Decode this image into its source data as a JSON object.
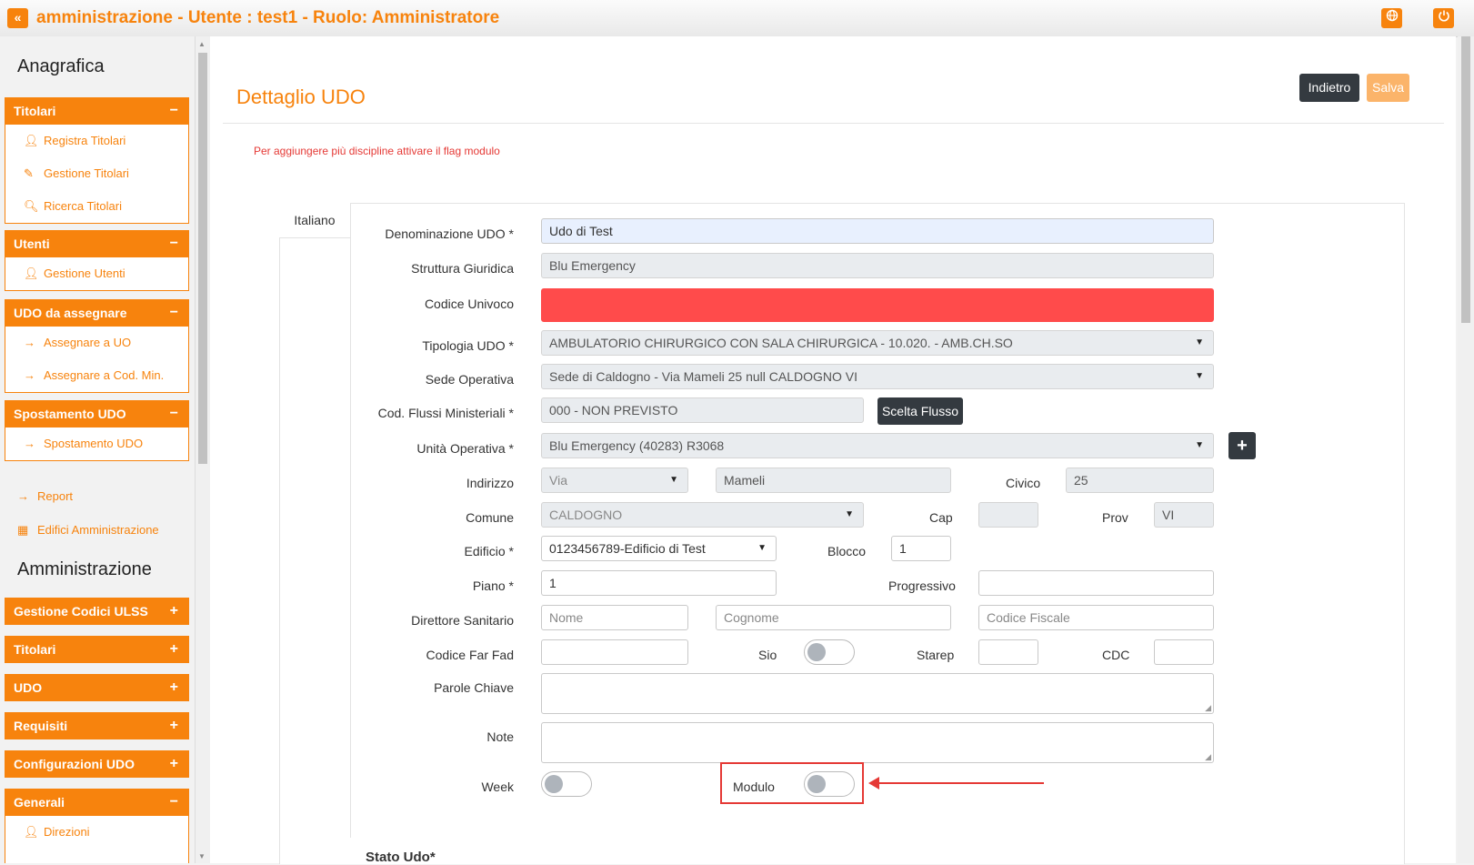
{
  "topbar": {
    "back_icon": "«",
    "title": "amministrazione - Utente : test1 - Ruolo: Amministratore",
    "globe_icon": "globe-icon",
    "power_icon": "power-icon"
  },
  "sidebar": {
    "section_anagrafica": "Anagrafica",
    "groups": [
      {
        "title": "Titolari",
        "toggle": "−",
        "items": [
          "Registra Titolari",
          "Gestione Titolari",
          "Ricerca Titolari"
        ]
      },
      {
        "title": "Utenti",
        "toggle": "−",
        "items": [
          "Gestione Utenti"
        ]
      },
      {
        "title": "UDO da assegnare",
        "toggle": "−",
        "items": [
          "Assegnare a UO",
          "Assegnare a Cod. Min."
        ]
      },
      {
        "title": "Spostamento UDO",
        "toggle": "−",
        "items": [
          "Spostamento UDO"
        ]
      }
    ],
    "loose_items": [
      "Report",
      "Edifici Amministrazione"
    ],
    "section_amministrazione": "Amministrazione",
    "admin_groups": [
      {
        "title": "Gestione Codici ULSS",
        "toggle": "+"
      },
      {
        "title": "Titolari",
        "toggle": "+"
      },
      {
        "title": "UDO",
        "toggle": "+"
      },
      {
        "title": "Requisiti",
        "toggle": "+"
      },
      {
        "title": "Configurazioni UDO",
        "toggle": "+"
      },
      {
        "title": "Generali",
        "toggle": "−",
        "items": [
          "Direzioni"
        ]
      }
    ]
  },
  "main": {
    "title": "Dettaglio UDO",
    "back_button": "Indietro",
    "save_button": "Salva",
    "hint": "Per aggiungere più discipline attivare il flag modulo",
    "tab": "Italiano",
    "form": {
      "denominazione_label": "Denominazione UDO *",
      "denominazione_value": "Udo di Test",
      "struttura_label": "Struttura Giuridica",
      "struttura_value": "Blu Emergency",
      "codice_label": "Codice Univoco",
      "tipologia_label": "Tipologia UDO *",
      "tipologia_value": "AMBULATORIO CHIRURGICO CON SALA CHIRURGICA - 10.020. - AMB.CH.SO",
      "sede_label": "Sede Operativa",
      "sede_value": "Sede di Caldogno - Via Mameli 25 null CALDOGNO VI",
      "flussi_label": "Cod. Flussi Ministeriali *",
      "flussi_value": "000 - NON PREVISTO",
      "flussi_button": "Scelta Flusso",
      "unita_label": "Unità Operativa *",
      "unita_value": "Blu Emergency (40283) R3068",
      "add_button": "+",
      "indirizzo_label": "Indirizzo",
      "indirizzo_tipo": "Via",
      "indirizzo_via": "Mameli",
      "civico_label": "Civico",
      "civico_value": "25",
      "comune_label": "Comune",
      "comune_value": "CALDOGNO",
      "cap_label": "Cap",
      "cap_value": "",
      "prov_label": "Prov",
      "prov_value": "VI",
      "edificio_label": "Edificio *",
      "edificio_value": "0123456789-Edificio di Test",
      "blocco_label": "Blocco",
      "blocco_value": "1",
      "piano_label": "Piano *",
      "piano_value": "1",
      "progressivo_label": "Progressivo",
      "progressivo_value": "",
      "direttore_label": "Direttore Sanitario",
      "nome_placeholder": "Nome",
      "cognome_placeholder": "Cognome",
      "cf_placeholder": "Codice Fiscale",
      "farfad_label": "Codice Far Fad",
      "sio_label": "Sio",
      "starep_label": "Starep",
      "cdc_label": "CDC",
      "parole_label": "Parole Chiave",
      "note_label": "Note",
      "week_label": "Week",
      "modulo_label": "Modulo",
      "stato_label": "Stato Udo*"
    }
  },
  "colors": {
    "accent": "#f7830d",
    "dark_button": "#343a40",
    "error": "#ff4b4b",
    "highlight": "#e53935"
  }
}
